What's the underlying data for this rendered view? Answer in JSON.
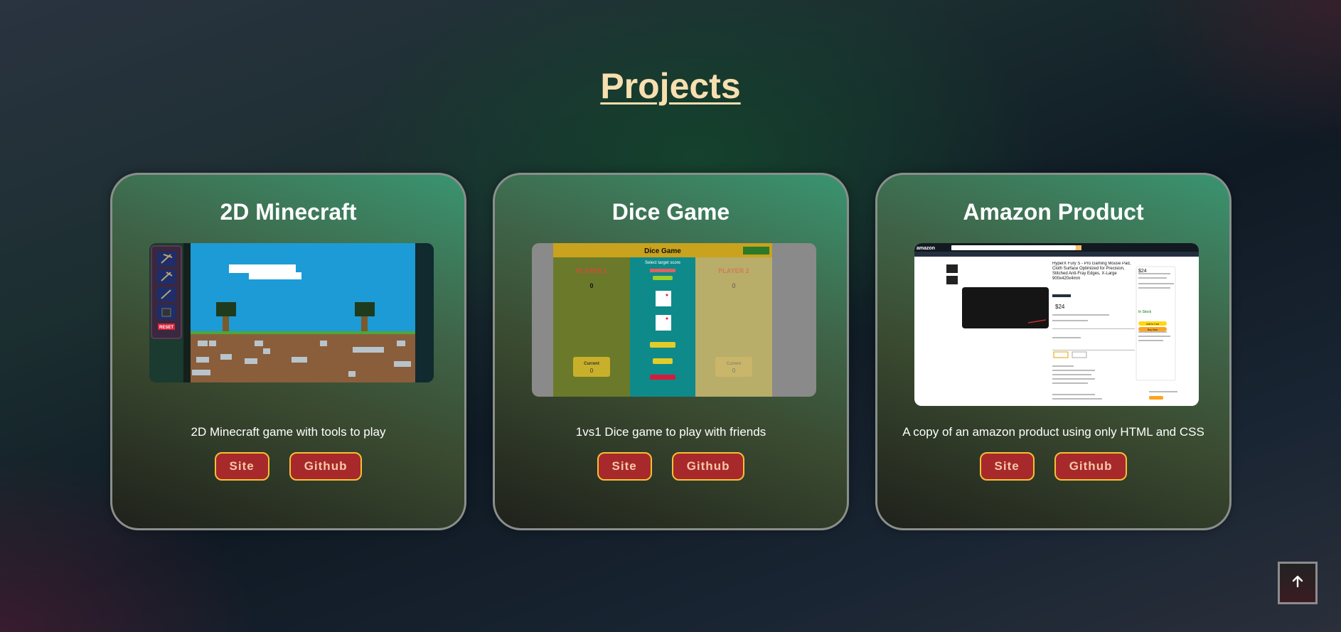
{
  "page": {
    "title": "Projects"
  },
  "projects": [
    {
      "title": "2D Minecraft",
      "description": "2D Minecraft game with tools to play",
      "site_label": "Site",
      "github_label": "Github"
    },
    {
      "title": "Dice Game",
      "description": "1vs1 Dice game to play with friends",
      "site_label": "Site",
      "github_label": "Github"
    },
    {
      "title": "Amazon Product",
      "description": "A copy of an amazon product using only HTML and CSS",
      "site_label": "Site",
      "github_label": "Github"
    }
  ],
  "previews": {
    "minecraft": {
      "reset_label": "RESET"
    },
    "dice": {
      "header": "Dice Game",
      "instruction": "Select target score",
      "player1": "PLAYER 1",
      "player2": "PLAYER 2",
      "score1": "0",
      "score2": "0",
      "current_label": "Current",
      "current1": "0",
      "current2": "0"
    },
    "amazon": {
      "logo": "amazon",
      "product_title": "HyperX Fury S - Pro Gaming Mouse Pad, Cloth Surface Optimized for Precision, Stitched Anti-Fray Edges, X-Large 900x420x4mm",
      "price": "$24",
      "in_stock": "In Stock",
      "add_to_cart": "Add to Cart",
      "buy_now": "Buy Now"
    }
  },
  "back_to_top": {
    "icon": "arrow-up-icon"
  },
  "colors": {
    "title": "#f7dfb0",
    "button_bg": "#a8292c",
    "button_border": "#f2c232",
    "button_text": "#f5c9a8"
  }
}
